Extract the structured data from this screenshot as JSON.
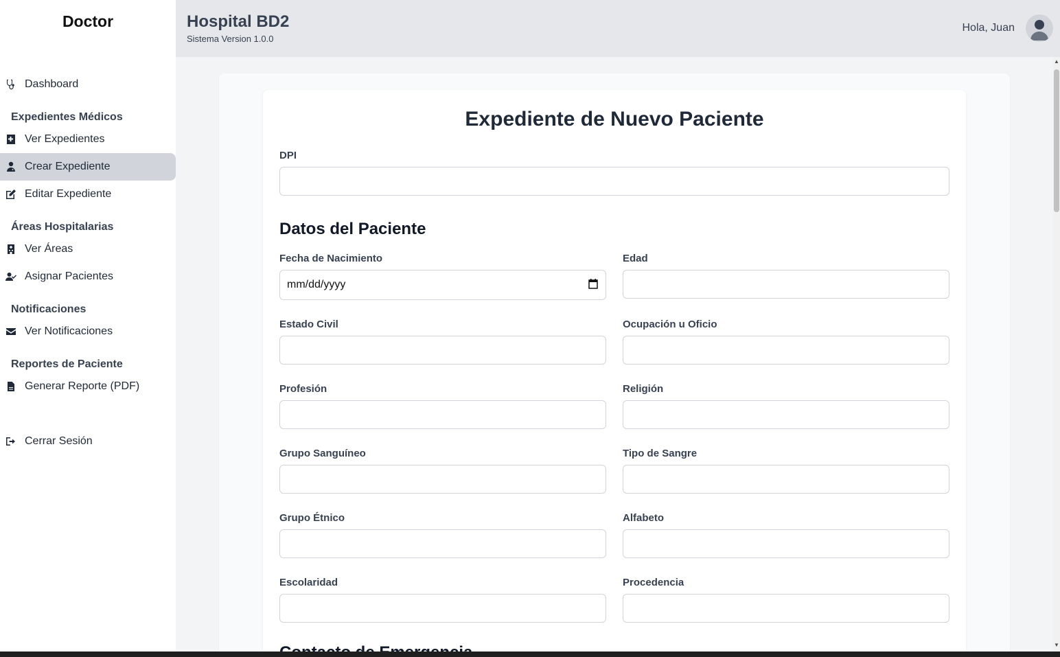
{
  "sidebar": {
    "brand": "Doctor",
    "dashboard": "Dashboard",
    "sections": {
      "records": "Expedientes Médicos",
      "areas": "Áreas Hospitalarias",
      "notifications": "Notificaciones",
      "reports": "Reportes de Paciente"
    },
    "items": {
      "view_records": "Ver Expedientes",
      "create_record": "Crear Expediente",
      "edit_record": "Editar Expediente",
      "view_areas": "Ver Áreas",
      "assign_patients": "Asignar Pacientes",
      "view_notifications": "Ver Notificaciones",
      "generate_report": "Generar Reporte (PDF)",
      "logout": "Cerrar Sesión"
    },
    "active_item": "Crear Expediente"
  },
  "header": {
    "title": "Hospital BD2",
    "version": "Sistema Version 1.0.0",
    "greeting": "Hola, Juan"
  },
  "form": {
    "title": "Expediente de Nuevo Paciente",
    "dpi_label": "DPI",
    "dpi_value": "",
    "patient_section": "Datos del Paciente",
    "fields": {
      "birth_date": {
        "label": "Fecha de Nacimiento",
        "placeholder": "mm/dd/yyyy"
      },
      "age": {
        "label": "Edad",
        "value": ""
      },
      "civil_status": {
        "label": "Estado Civil",
        "value": ""
      },
      "occupation": {
        "label": "Ocupación u Oficio",
        "value": ""
      },
      "profession": {
        "label": "Profesión",
        "value": ""
      },
      "religion": {
        "label": "Religión",
        "value": ""
      },
      "blood_group": {
        "label": "Grupo Sanguíneo",
        "value": ""
      },
      "blood_type": {
        "label": "Tipo de Sangre",
        "value": ""
      },
      "ethnic_group": {
        "label": "Grupo Étnico",
        "value": ""
      },
      "literacy": {
        "label": "Alfabeto",
        "value": ""
      },
      "schooling": {
        "label": "Escolaridad",
        "value": ""
      },
      "origin": {
        "label": "Procedencia",
        "value": ""
      }
    },
    "next_section_partial": "Contacto de Emergencia"
  },
  "icons": {
    "dashboard": "stethoscope-icon",
    "view_records": "file-medical-icon",
    "create_record": "user-doctor-icon",
    "edit_record": "edit-icon",
    "view_areas": "hospital-icon",
    "assign_patients": "user-check-icon",
    "view_notifications": "envelope-icon",
    "generate_report": "file-pdf-icon",
    "logout": "sign-out-icon",
    "avatar": "user-avatar-icon",
    "calendar": "calendar-icon"
  },
  "colors": {
    "sidebar_active": "#d1d5db",
    "header_bg": "#e5e7eb",
    "main_bg": "#f3f4f6"
  }
}
